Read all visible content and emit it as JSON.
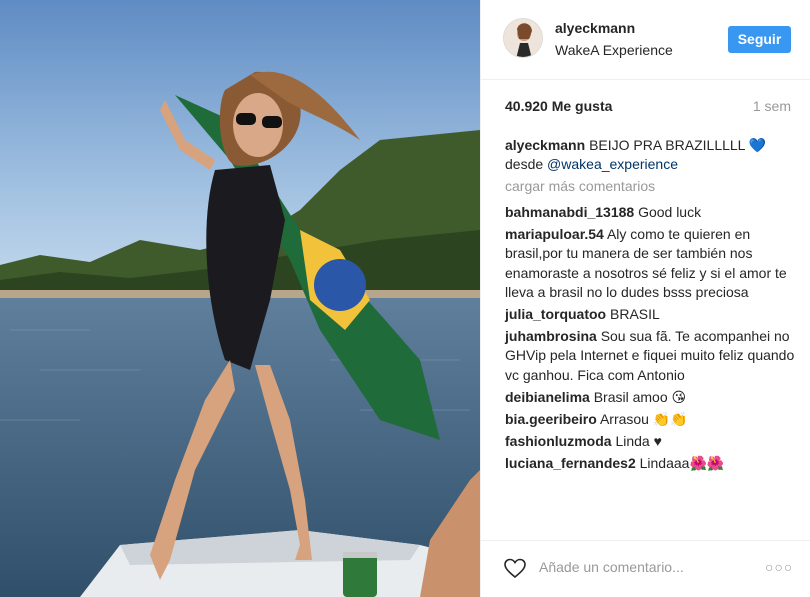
{
  "post": {
    "username": "alyeckmann",
    "location": "WakeA Experience",
    "follow_label": "Seguir",
    "likes": "40.920 Me gusta",
    "time": "1 sem",
    "caption_text": "BEIJO PRA BRAZILLLLL 💙 desde ",
    "caption_tag": "@wakea_experience",
    "load_more": "cargar más comentarios",
    "add_comment_placeholder": "Añade un comentario...",
    "more_icon": "ellipsis-icon",
    "like_icon": "heart-outline-icon"
  },
  "comments": [
    {
      "user": "bahmanabdi_13188",
      "text": "Good luck"
    },
    {
      "user": "mariapuloar.54",
      "text": "Aly como te quieren en brasil,por tu manera de ser también nos enamoraste a nosotros sé feliz y si el amor te lleva a brasil no lo dudes bsss preciosa"
    },
    {
      "user": "julia_torquatoo",
      "text": "BRASIL"
    },
    {
      "user": "juhambrosina",
      "text": "Sou sua fã. Te acompanhei no GHVip pela Internet e fiquei muito feliz quando vc ganhou. Fica com Antonio"
    },
    {
      "user": "deibianelima",
      "text": "Brasil amoo 😘"
    },
    {
      "user": "bia.geeribeiro",
      "text": "Arrasou 👏👏"
    },
    {
      "user": "fashionluzmoda",
      "text": "Linda ♥"
    },
    {
      "user": "luciana_fernandes2",
      "text": "Lindaaa🌺🌺"
    }
  ],
  "colors": {
    "follow_button": "#3897f0",
    "hashtag": "#003569",
    "muted": "#999999"
  }
}
